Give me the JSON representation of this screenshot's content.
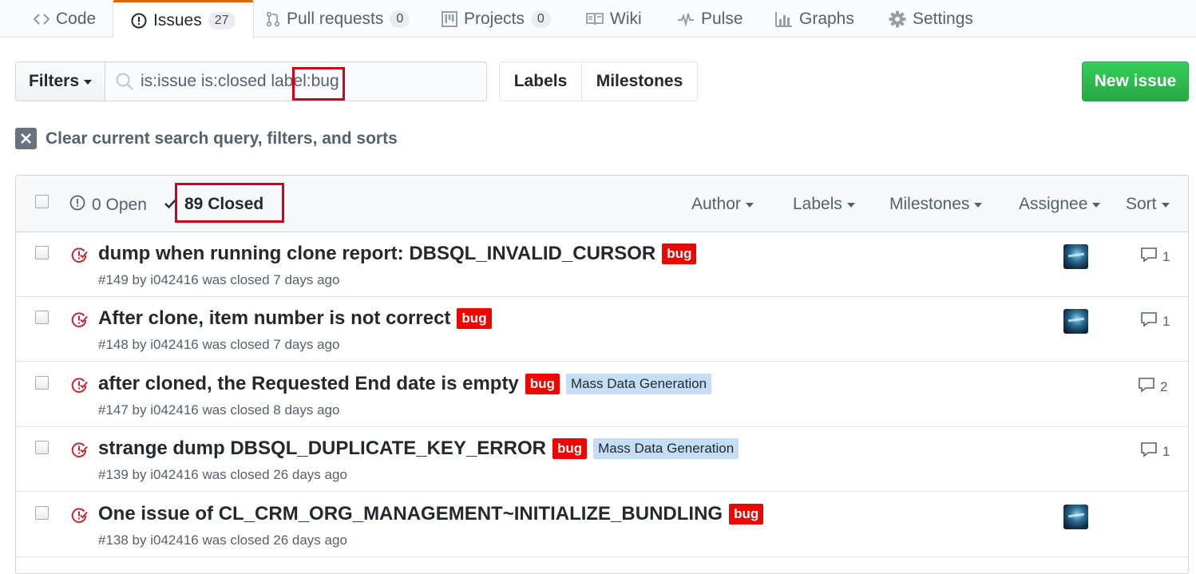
{
  "tabs": [
    {
      "label": "Code",
      "icon": "code-icon",
      "count": ""
    },
    {
      "label": "Issues",
      "icon": "issue-opened-icon",
      "count": "27"
    },
    {
      "label": "Pull requests",
      "icon": "git-pull-request-icon",
      "count": "0"
    },
    {
      "label": "Projects",
      "icon": "project-icon",
      "count": "0"
    },
    {
      "label": "Wiki",
      "icon": "book-icon",
      "count": ""
    },
    {
      "label": "Pulse",
      "icon": "pulse-icon",
      "count": ""
    },
    {
      "label": "Graphs",
      "icon": "graph-icon",
      "count": ""
    },
    {
      "label": "Settings",
      "icon": "gear-icon",
      "count": ""
    }
  ],
  "filters": {
    "button_label": "Filters",
    "search_value": "is:issue is:closed label:bug"
  },
  "labels_button": "Labels",
  "milestones_button": "Milestones",
  "new_issue_button": "New issue",
  "clear_query_label": "Clear current search query, filters, and sorts",
  "header": {
    "open_label": "0 Open",
    "closed_label": "89 Closed",
    "menus": [
      "Author",
      "Labels",
      "Milestones",
      "Assignee",
      "Sort"
    ]
  },
  "issues": [
    {
      "title": "dump when running clone report: DBSQL_INVALID_CURSOR",
      "labels": [
        {
          "name": "bug",
          "bg": "#ee0701",
          "fg": "#ffffff"
        }
      ],
      "meta": "#149 by i042416 was closed 7 days ago",
      "has_avatar": true,
      "comments": "1"
    },
    {
      "title": "After clone, item number is not correct",
      "labels": [
        {
          "name": "bug",
          "bg": "#ee0701",
          "fg": "#ffffff"
        }
      ],
      "meta": "#148 by i042416 was closed 7 days ago",
      "has_avatar": true,
      "comments": "1"
    },
    {
      "title": "after cloned, the Requested End date is empty",
      "labels": [
        {
          "name": "bug",
          "bg": "#ee0701",
          "fg": "#ffffff"
        },
        {
          "name": "Mass Data Generation",
          "bg": "#c5def5",
          "fg": "#24292e"
        }
      ],
      "meta": "#147 by i042416 was closed 8 days ago",
      "has_avatar": false,
      "comments": "2"
    },
    {
      "title": "strange dump DBSQL_DUPLICATE_KEY_ERROR",
      "labels": [
        {
          "name": "bug",
          "bg": "#ee0701",
          "fg": "#ffffff"
        },
        {
          "name": "Mass Data Generation",
          "bg": "#c5def5",
          "fg": "#24292e"
        }
      ],
      "meta": "#139 by i042416 was closed 26 days ago",
      "has_avatar": false,
      "comments": "1"
    },
    {
      "title": "One issue of CL_CRM_ORG_MANAGEMENT~INITIALIZE_BUNDLING",
      "labels": [
        {
          "name": "bug",
          "bg": "#ee0701",
          "fg": "#ffffff"
        }
      ],
      "meta": "#138 by i042416 was closed 26 days ago",
      "has_avatar": true,
      "comments": ""
    }
  ],
  "colors": {
    "accent_tab": "#e36209",
    "closed_issue_icon": "#cb2431",
    "highlight_box": "#d0021b",
    "new_issue_green": "#28a745"
  }
}
